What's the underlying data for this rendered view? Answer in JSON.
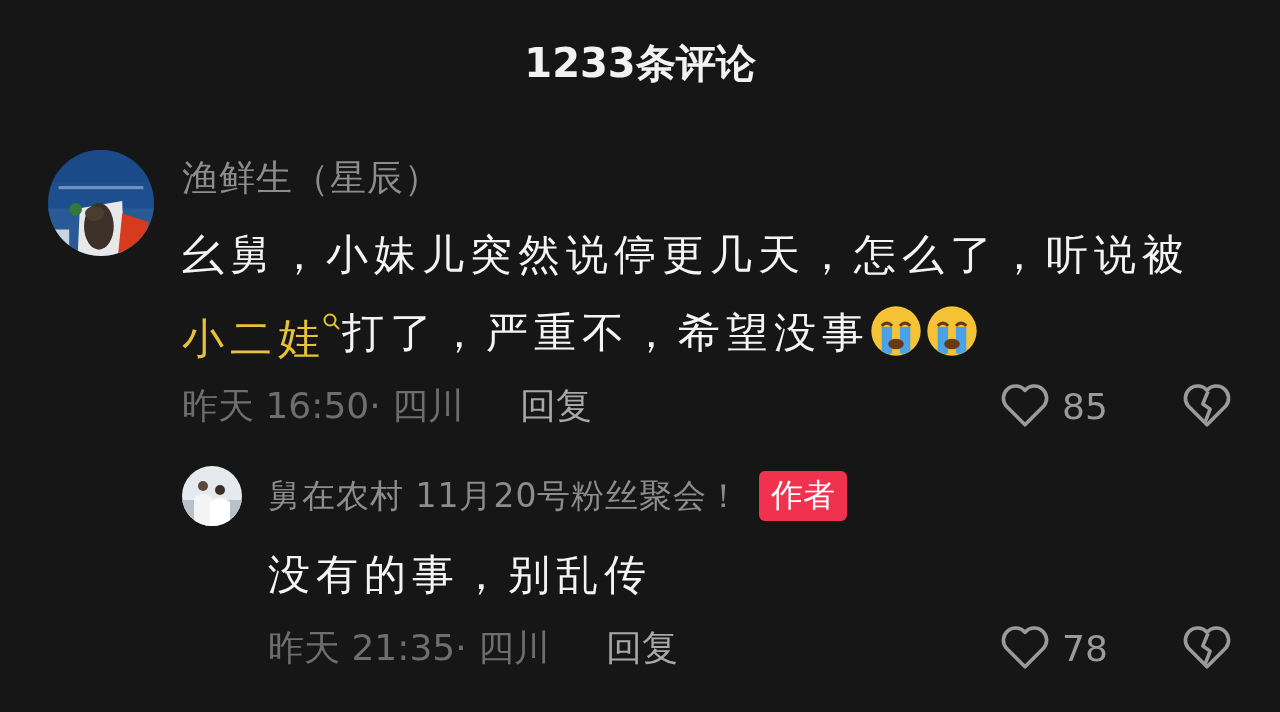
{
  "header": {
    "title": "1233条评论"
  },
  "comments": [
    {
      "author": "渔鲜生（星辰）",
      "body": [
        {
          "kind": "text",
          "text": "幺舅，小妹儿突然说停更几天，怎么了，听说被"
        },
        {
          "kind": "link",
          "text": "小二娃"
        },
        {
          "kind": "text",
          "text": "打了，严重不，希望没事"
        },
        {
          "kind": "emoji"
        },
        {
          "kind": "emoji"
        }
      ],
      "time": "昨天 16:50· 四川",
      "reply_label": "回复",
      "likes": "85",
      "replies": [
        {
          "author": "舅在农村 11月20号粉丝聚会！",
          "badge": "作者",
          "body": [
            {
              "kind": "text",
              "text": "没有的事，别乱传"
            }
          ],
          "time": "昨天 21:35· 四川",
          "reply_label": "回复",
          "likes": "78"
        }
      ]
    }
  ]
}
